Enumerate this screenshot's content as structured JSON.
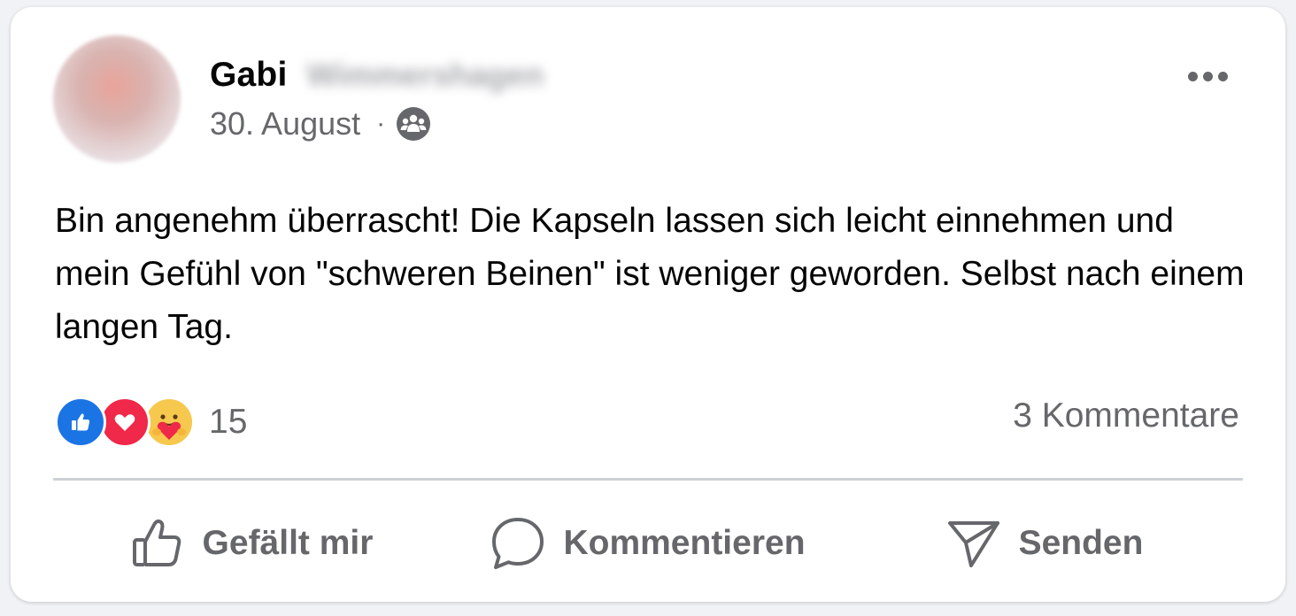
{
  "post": {
    "author_first_name": "Gabi",
    "author_last_name_blurred": "Wimmershagen",
    "date": "30. August",
    "separator": "·",
    "audience_icon": "group-icon",
    "more_icon": "more-options-icon",
    "text": "Bin angenehm überrascht! Die Kapseln lassen sich leicht einnehmen und mein Gefühl von \"schweren Beinen\" ist weniger geworden. Selbst nach einem langen Tag."
  },
  "reactions": {
    "icons": [
      "like-reaction-icon",
      "love-reaction-icon",
      "care-reaction-icon"
    ],
    "count": "15",
    "comments": "3 Kommentare"
  },
  "actions": {
    "like_label": "Gefällt mir",
    "comment_label": "Kommentieren",
    "send_label": "Senden"
  },
  "colors": {
    "like_blue": "#1b74e4",
    "love_red": "#f02849",
    "care_yellow": "#f7c84e",
    "secondary_text": "#65676b"
  }
}
